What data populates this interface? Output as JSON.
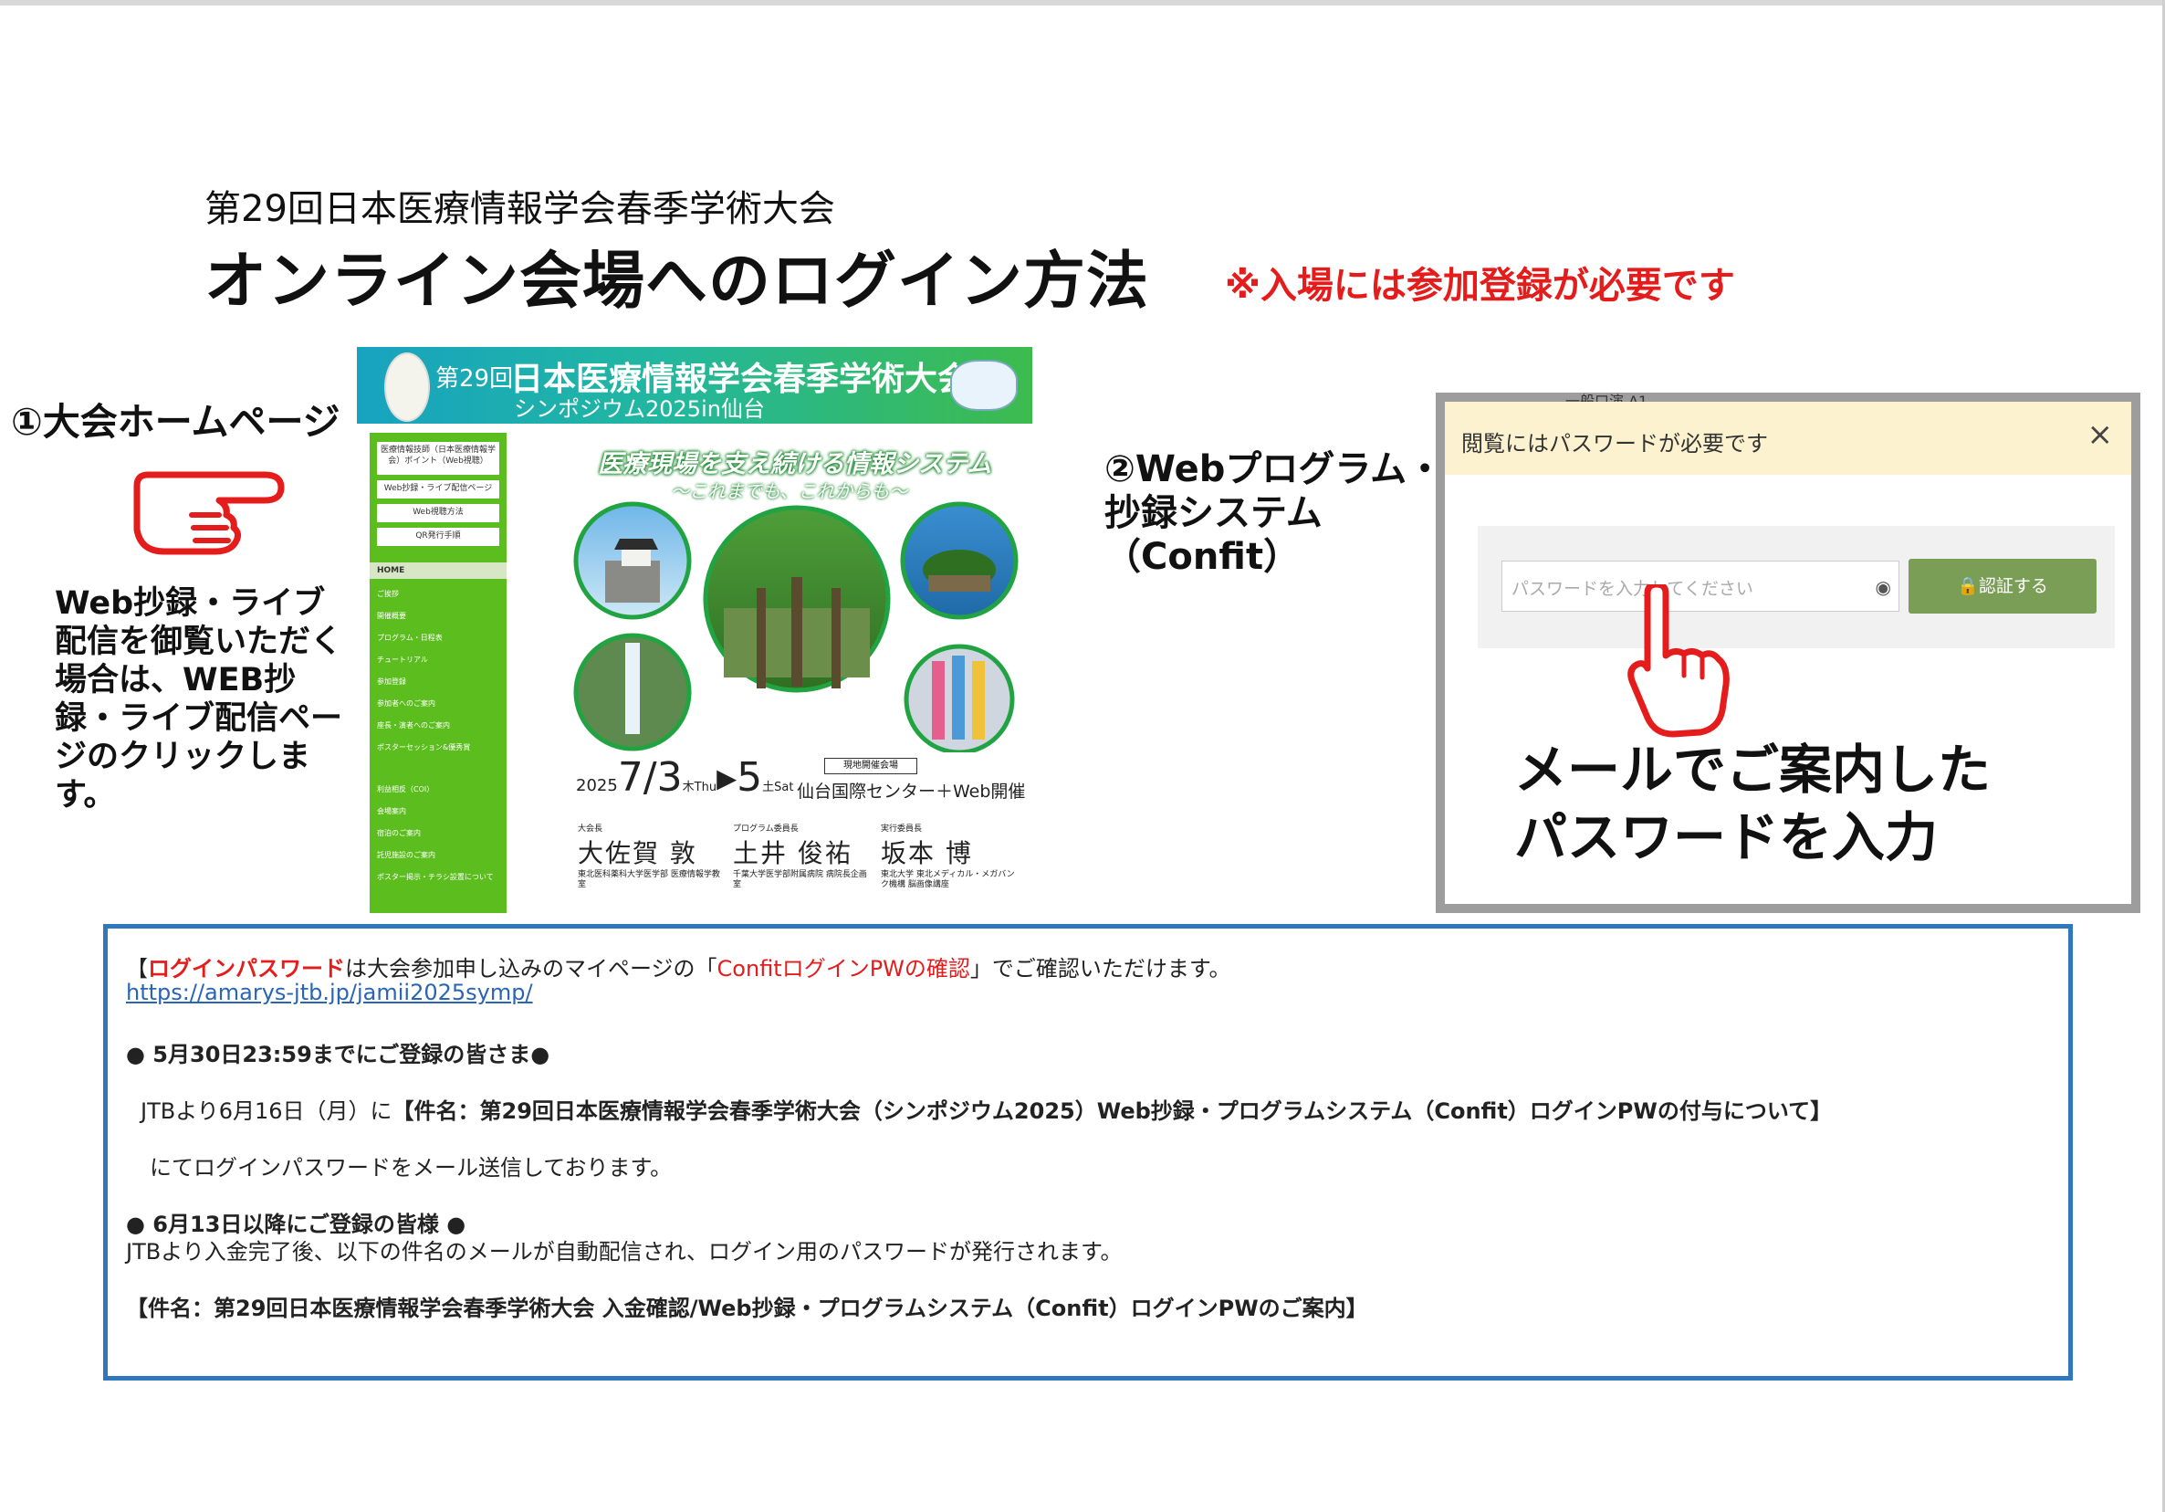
{
  "header": {
    "subtitle": "第29回日本医療情報学会春季学術大会",
    "title": "オンライン会場へのログイン方法",
    "notice": "※入場には参加登録が必要です"
  },
  "step1": {
    "label": "①大会ホームページ",
    "description": "Web抄録・ライブ配信を御覧いただく場合は、WEB抄録・ライブ配信ページのクリックします。"
  },
  "homepage": {
    "ordinal": "第29回",
    "title": "日本医療情報学会春季学術大会",
    "symposium": "シンポジウム2025in仙台",
    "sidebar_boxes": [
      "医療情報技師（日本医療情報学会）ポイント（Web視聴）",
      "Web抄録・ライブ配信ページ",
      "Web視聴方法",
      "QR発行手順"
    ],
    "home_label": "HOME",
    "menu": [
      "ご挨拶",
      "開催概要",
      "プログラム・日程表",
      "チュートリアル",
      "参加登録",
      "参加者へのご案内",
      "座長・演者へのご案内",
      "ポスターセッション&優秀賞",
      "利益相反（COI）",
      "会場案内",
      "宿泊のご案内",
      "託児施設のご案内",
      "ポスター掲示・チラシ設置について"
    ],
    "tagline": "医療現場を支え続ける情報システム",
    "tagline_sub": "〜これまでも、これからも〜",
    "date_year": "2025",
    "date_start": "7/3",
    "date_start_dow": "木",
    "date_start_en": "Thu",
    "date_end": "5",
    "date_end_dow": "土",
    "date_end_en": "Sat",
    "venue_tag": "現地開催会場",
    "venue": "仙台国際センター＋Web開催",
    "organizers": [
      {
        "role": "大会長",
        "name": "大佐賀 敦",
        "affiliation": "東北医科薬科大学医学部 医療情報学教室"
      },
      {
        "role": "プログラム委員長",
        "name": "土井 俊祐",
        "affiliation": "千葉大学医学部附属病院 病院長企画室"
      },
      {
        "role": "実行委員長",
        "name": "坂本 博",
        "affiliation": "東北大学 東北メディカル・メガバンク機構 脳画像講座"
      }
    ]
  },
  "step2": {
    "label_line1": "②Webプログラム・",
    "label_line2": "抄録システム",
    "label_line3": "（Confit）"
  },
  "confit": {
    "bg_hint": "一般口演 A1",
    "modal_title": "閲覧にはパスワードが必要です",
    "close": "×",
    "password_placeholder": "パスワードを入力してください",
    "eye": "◉",
    "auth_button": "🔒認証する",
    "instruction_line1": "メールでご案内した",
    "instruction_line2": "パスワードを入力"
  },
  "info": {
    "line1_prefix": "【",
    "line1_red1": "ログインパスワード",
    "line1_mid": "は大会参加申し込みのマイページの「",
    "line1_red2": "ConfitログインPWの確認",
    "line1_suffix": "」でご確認いただけます。",
    "url": "https://amarys-jtb.jp/jamii2025symp/",
    "section1_heading": "● 5月30日23:59までにご登録の皆さま●",
    "section1_line1_prefix": "JTBより6月16日（月）に",
    "section1_line1_bold": "【件名：第29回日本医療情報学会春季学術大会（シンポジウム2025）Web抄録・プログラムシステム（Confit）ログインPWの付与について】",
    "section1_line2": "にてログインパスワードをメール送信しております。",
    "section2_heading": "● 6月13日以降にご登録の皆様 ●",
    "section2_line1": "JTBより入金完了後、以下の件名のメールが自動配信され、ログイン用のパスワードが発行されます。",
    "section2_line2": "【件名：第29回日本医療情報学会春季学術大会 入金確認/Web抄録・プログラムシステム（Confit）ログインPWのご案内】"
  },
  "colors": {
    "accent_red": "#e51c1c",
    "box_border": "#2f78be",
    "sidebar_green": "#5cbd1e",
    "confit_button": "#7a9e55",
    "modal_header": "#fdf2cf"
  }
}
